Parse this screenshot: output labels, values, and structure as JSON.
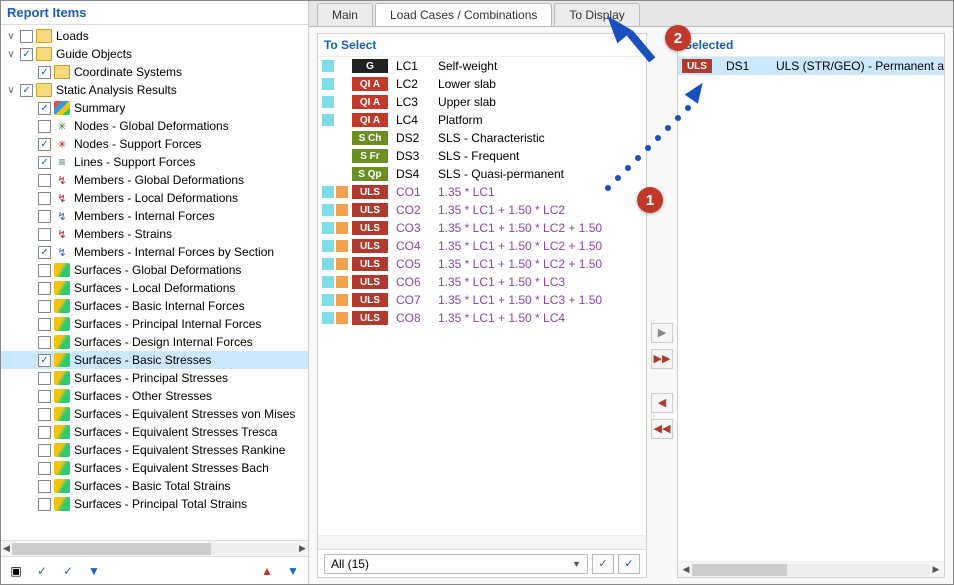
{
  "left": {
    "title": "Report Items",
    "tree": [
      {
        "indent": 0,
        "expander": "∨",
        "checked": false,
        "kind": "folder",
        "label": "Loads"
      },
      {
        "indent": 0,
        "expander": "∨",
        "checked": true,
        "kind": "folder",
        "label": "Guide Objects"
      },
      {
        "indent": 1,
        "expander": "",
        "checked": true,
        "kind": "folder",
        "label": "Coordinate Systems"
      },
      {
        "indent": 0,
        "expander": "∨",
        "checked": true,
        "kind": "folder",
        "label": "Static Analysis Results"
      },
      {
        "indent": 1,
        "expander": "",
        "checked": true,
        "kind": "summary",
        "label": "Summary"
      },
      {
        "indent": 1,
        "expander": "",
        "checked": false,
        "kind": "node",
        "label": "Nodes - Global Deformations"
      },
      {
        "indent": 1,
        "expander": "",
        "checked": true,
        "kind": "node2",
        "label": "Nodes - Support Forces"
      },
      {
        "indent": 1,
        "expander": "",
        "checked": true,
        "kind": "line",
        "label": "Lines - Support Forces"
      },
      {
        "indent": 1,
        "expander": "",
        "checked": false,
        "kind": "m1",
        "label": "Members - Global Deformations"
      },
      {
        "indent": 1,
        "expander": "",
        "checked": false,
        "kind": "m1",
        "label": "Members - Local Deformations"
      },
      {
        "indent": 1,
        "expander": "",
        "checked": false,
        "kind": "m2",
        "label": "Members - Internal Forces"
      },
      {
        "indent": 1,
        "expander": "",
        "checked": false,
        "kind": "m1",
        "label": "Members - Strains"
      },
      {
        "indent": 1,
        "expander": "",
        "checked": true,
        "kind": "m2",
        "label": "Members - Internal Forces by Section"
      },
      {
        "indent": 1,
        "expander": "",
        "checked": false,
        "kind": "surf",
        "label": "Surfaces - Global Deformations"
      },
      {
        "indent": 1,
        "expander": "",
        "checked": false,
        "kind": "surf",
        "label": "Surfaces - Local Deformations"
      },
      {
        "indent": 1,
        "expander": "",
        "checked": false,
        "kind": "surf",
        "label": "Surfaces - Basic Internal Forces"
      },
      {
        "indent": 1,
        "expander": "",
        "checked": false,
        "kind": "surf",
        "label": "Surfaces - Principal Internal Forces"
      },
      {
        "indent": 1,
        "expander": "",
        "checked": false,
        "kind": "surf",
        "label": "Surfaces - Design Internal Forces"
      },
      {
        "indent": 1,
        "expander": "",
        "checked": true,
        "kind": "surf",
        "label": "Surfaces - Basic Stresses",
        "selected": true
      },
      {
        "indent": 1,
        "expander": "",
        "checked": false,
        "kind": "surf",
        "label": "Surfaces - Principal Stresses"
      },
      {
        "indent": 1,
        "expander": "",
        "checked": false,
        "kind": "surf",
        "label": "Surfaces - Other Stresses"
      },
      {
        "indent": 1,
        "expander": "",
        "checked": false,
        "kind": "surf",
        "label": "Surfaces - Equivalent Stresses von Mises"
      },
      {
        "indent": 1,
        "expander": "",
        "checked": false,
        "kind": "surf",
        "label": "Surfaces - Equivalent Stresses Tresca"
      },
      {
        "indent": 1,
        "expander": "",
        "checked": false,
        "kind": "surf",
        "label": "Surfaces - Equivalent Stresses Rankine"
      },
      {
        "indent": 1,
        "expander": "",
        "checked": false,
        "kind": "surf",
        "label": "Surfaces - Equivalent Stresses Bach"
      },
      {
        "indent": 1,
        "expander": "",
        "checked": false,
        "kind": "surf",
        "label": "Surfaces - Basic Total Strains"
      },
      {
        "indent": 1,
        "expander": "",
        "checked": false,
        "kind": "surf",
        "label": "Surfaces - Principal Total Strains"
      }
    ]
  },
  "tabs": {
    "t1": "Main",
    "t2": "Load Cases / Combinations",
    "t3": "To Display"
  },
  "toSelect": {
    "header": "To Select",
    "rows": [
      {
        "c1": "c-cyan",
        "c2": "",
        "tagClass": "tag-g",
        "tag": "G",
        "id": "LC1",
        "desc": "Self-weight",
        "co": false
      },
      {
        "c1": "c-cyan",
        "c2": "",
        "tagClass": "tag-q",
        "tag": "QI A",
        "id": "LC2",
        "desc": "Lower slab",
        "co": false
      },
      {
        "c1": "c-cyan",
        "c2": "",
        "tagClass": "tag-q",
        "tag": "QI A",
        "id": "LC3",
        "desc": "Upper slab",
        "co": false
      },
      {
        "c1": "c-cyan",
        "c2": "",
        "tagClass": "tag-q",
        "tag": "QI A",
        "id": "LC4",
        "desc": "Platform",
        "co": false
      },
      {
        "c1": "",
        "c2": "",
        "tagClass": "tag-sch",
        "tag": "S Ch",
        "id": "DS2",
        "desc": "SLS - Characteristic",
        "co": false
      },
      {
        "c1": "",
        "c2": "",
        "tagClass": "tag-sfr",
        "tag": "S Fr",
        "id": "DS3",
        "desc": "SLS - Frequent",
        "co": false
      },
      {
        "c1": "",
        "c2": "",
        "tagClass": "tag-sqp",
        "tag": "S Qp",
        "id": "DS4",
        "desc": "SLS - Quasi-permanent",
        "co": false
      },
      {
        "c1": "c-cyan",
        "c2": "c-orange",
        "tagClass": "tag-uls",
        "tag": "ULS",
        "id": "CO1",
        "desc": "1.35 * LC1",
        "co": true
      },
      {
        "c1": "c-cyan",
        "c2": "c-orange",
        "tagClass": "tag-uls",
        "tag": "ULS",
        "id": "CO2",
        "desc": "1.35 * LC1 + 1.50 * LC2",
        "co": true
      },
      {
        "c1": "c-cyan",
        "c2": "c-orange",
        "tagClass": "tag-uls",
        "tag": "ULS",
        "id": "CO3",
        "desc": "1.35 * LC1 + 1.50 * LC2 + 1.50",
        "co": true
      },
      {
        "c1": "c-cyan",
        "c2": "c-orange",
        "tagClass": "tag-uls",
        "tag": "ULS",
        "id": "CO4",
        "desc": "1.35 * LC1 + 1.50 * LC2 + 1.50",
        "co": true
      },
      {
        "c1": "c-cyan",
        "c2": "c-orange",
        "tagClass": "tag-uls",
        "tag": "ULS",
        "id": "CO5",
        "desc": "1.35 * LC1 + 1.50 * LC2 + 1.50",
        "co": true
      },
      {
        "c1": "c-cyan",
        "c2": "c-orange",
        "tagClass": "tag-uls",
        "tag": "ULS",
        "id": "CO6",
        "desc": "1.35 * LC1 + 1.50 * LC3",
        "co": true
      },
      {
        "c1": "c-cyan",
        "c2": "c-orange",
        "tagClass": "tag-uls",
        "tag": "ULS",
        "id": "CO7",
        "desc": "1.35 * LC1 + 1.50 * LC3 + 1.50",
        "co": true
      },
      {
        "c1": "c-cyan",
        "c2": "c-orange",
        "tagClass": "tag-uls",
        "tag": "ULS",
        "id": "CO8",
        "desc": "1.35 * LC1 + 1.50 * LC4",
        "co": true
      }
    ],
    "filter": "All (15)"
  },
  "moveButtons": {
    "addOne": "▶",
    "addAll": "▶▶",
    "remOne": "◀",
    "remAll": "◀◀"
  },
  "selected": {
    "header": "Selected",
    "row": {
      "tag": "ULS",
      "id": "DS1",
      "desc": "ULS (STR/GEO) - Permanent a"
    }
  },
  "toolbarIcons": {
    "panel": "▣",
    "checkAll": "✓",
    "uncheckAll": "✓",
    "filter": "▼",
    "up": "▲",
    "down": "▼"
  },
  "annotations": {
    "one": "1",
    "two": "2"
  }
}
